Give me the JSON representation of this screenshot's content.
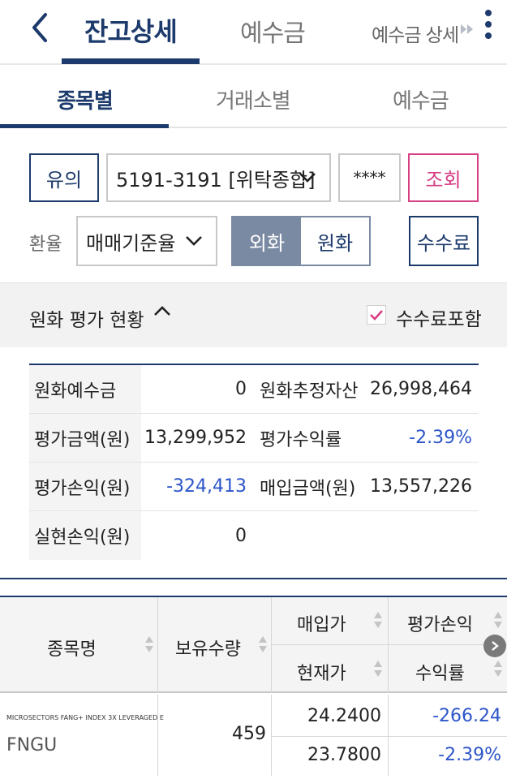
{
  "header": {
    "tabs": [
      "잔고상세",
      "예수금",
      "예수금 상세"
    ]
  },
  "subtabs": [
    "종목별",
    "거래소별",
    "예수금"
  ],
  "controls": {
    "notice_label": "유의",
    "account": "5191-3191 [위탁종합]",
    "password_mask": "****",
    "inquiry_label": "조회",
    "rate_label": "환율",
    "rate_type": "매매기준율",
    "currency_foreign": "외화",
    "currency_krw": "원화",
    "fee_button": "수수료"
  },
  "section": {
    "title": "원화 평가 현황",
    "fee_include_label": "수수료포함",
    "fee_include_checked": true
  },
  "summary": {
    "rows": [
      {
        "l1": "원화예수금",
        "v1": "0",
        "l2": "원화추정자산",
        "v2": "26,998,464"
      },
      {
        "l1": "평가금액(원)",
        "v1": "13,299,952",
        "l2": "평가수익률",
        "v2": "-2.39%"
      },
      {
        "l1": "평가손익(원)",
        "v1": "-324,413",
        "l2": "매입금액(원)",
        "v2": "13,557,226"
      },
      {
        "l1": "실현손익(원)",
        "v1": "0",
        "l2": "",
        "v2": ""
      }
    ]
  },
  "table": {
    "headers": {
      "name": "종목명",
      "qty": "보유수량",
      "buy_price": "매입가",
      "current_price": "현재가",
      "pnl": "평가손익",
      "return": "수익률"
    },
    "rows": [
      {
        "name_en": "MICROSECTORS FANG+ INDEX 3X LEVERAGED E",
        "ticker": "FNGU",
        "qty": "459",
        "buy_price": "24.2400",
        "current_price": "23.7800",
        "pnl": "-266.24",
        "return": "-2.39%"
      }
    ]
  },
  "colors": {
    "navy": "#1c3a6b",
    "negative_blue": "#2c55c8",
    "pink": "#d63f84",
    "segment_on": "#7b8aa3"
  }
}
